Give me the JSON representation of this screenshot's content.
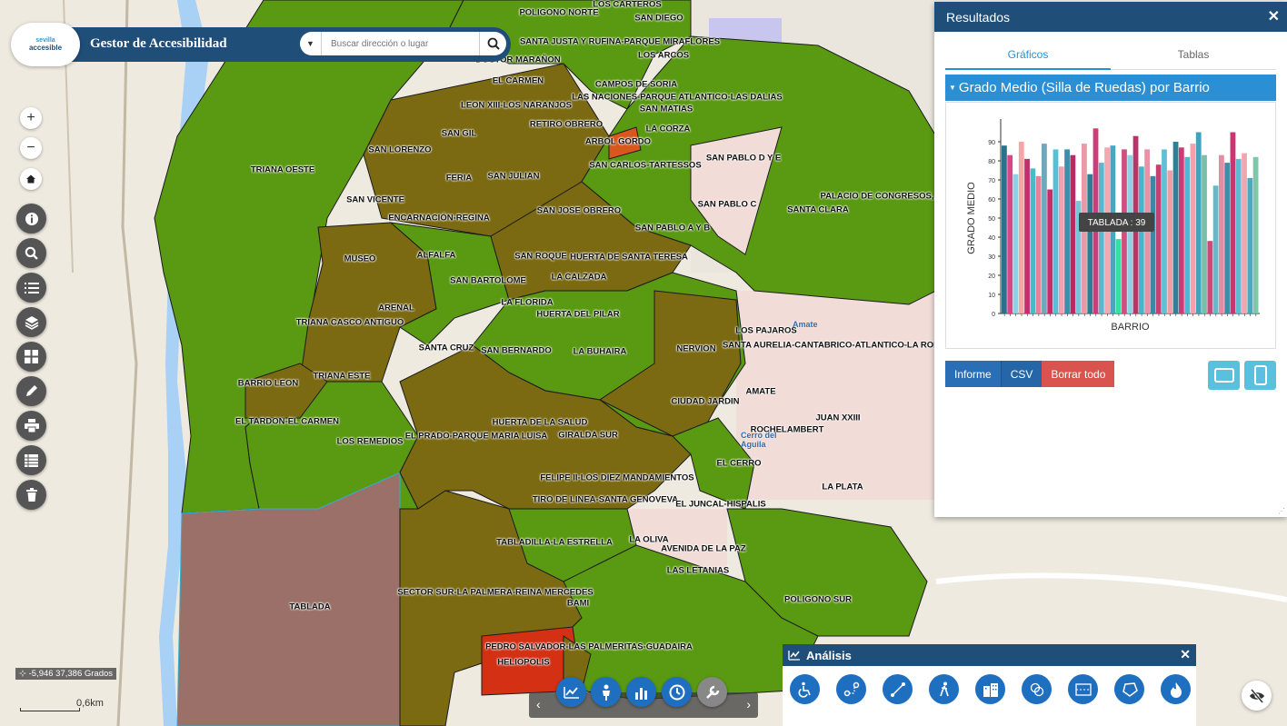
{
  "app": {
    "title": "Gestor de Accesibilidad",
    "logo_text_top": "sevilla",
    "logo_text": "accesible",
    "search_placeholder": "Buscar dirección o lugar"
  },
  "map": {
    "coords": "-5,946 37,386 Grados",
    "scale": "0,6km",
    "neighborhoods": [
      "LOS CARTEROS",
      "POLIGONO NORTE",
      "SAN DIEGO",
      "SANTA JUSTA Y RUFINA-PARQUE MIRAFLORES",
      "LOS ARCOS",
      "DOCTOR MARAÑON",
      "EL CARMEN",
      "CAMPOS DE SORIA",
      "LAS NACIONES-PARQUE ATLANTICO-LAS DALIAS",
      "LEON XIII-LOS NARANJOS",
      "SAN MATIAS",
      "RETIRO OBRERO",
      "LA CORZA",
      "SAN GIL",
      "ARBOL GORDO",
      "SAN LORENZO",
      "SAN PABLO D Y E",
      "SAN CARLOS-TARTESSOS",
      "TRIANA OESTE",
      "FERIA",
      "SAN JULIAN",
      "PALACIO DE CONGRESOS,",
      "SAN VICENTE",
      "SAN PABLO C",
      "SAN JOSE OBRERO",
      "SANTA CLARA",
      "ENCARNACIÓN-REGINA",
      "SAN PABLO A Y B",
      "ALFALFA",
      "SAN ROQUE",
      "HUERTA DE SANTA TERESA",
      "MUSEO",
      "LA CALZADA",
      "SAN BARTOLOME",
      "ARENAL",
      "LA FLORIDA",
      "HUERTA DEL PILAR",
      "TRIANA CASCO ANTIGUO",
      "LOS PAJAROS",
      "SANTA CRUZ",
      "SAN BERNARDO",
      "LA BUHAIRA",
      "NERVION",
      "SANTA AURELIA-CANTABRICO-ATLANTICO-LA ROM",
      "TRIANA ESTE",
      "BARRIO LEON",
      "AMATE",
      "CIUDAD JARDIN",
      "JUAN XXIII",
      "EL TARDON-EL CARMEN",
      "HUERTA DE LA SALUD",
      "ROCHELAMBERT",
      "LOS REMEDIOS",
      "EL PRADO-PARQUE MARIA LUISA",
      "GIRALDA SUR",
      "EL CERRO",
      "FELIPE II-LOS DIEZ MANDAMIENTOS",
      "LA PLATA",
      "TIRO DE LINEA-SANTA GENOVEVA",
      "EL JUNCAL-HISPALIS",
      "LA OLIVA",
      "TABLADILLA-LA ESTRELLA",
      "AVENIDA DE LA PAZ",
      "LAS LETANIAS",
      "TABLADA",
      "SECTOR SUR-LA PALMERA-REINA MERCEDES",
      "BAMI",
      "POLIGONO SUR",
      "PEDRO SALVADOR-LAS PALMERITAS-GUADAIRA",
      "HELIOPOLIS"
    ],
    "places": [
      "Amate",
      "Cerro del Aguila"
    ]
  },
  "results": {
    "title": "Resultados",
    "tabs": [
      "Gráficos",
      "Tablas"
    ],
    "accordion_title": "Grado Medio (Silla de Ruedas) por Barrio",
    "buttons": {
      "informe": "Informe",
      "csv": "CSV",
      "borrar": "Borrar todo"
    },
    "tooltip": "TABLADA : 39"
  },
  "chart_data": {
    "type": "bar",
    "xlabel": "BARRIO",
    "ylabel": "GRADO MEDIO",
    "ylim": [
      0,
      100
    ],
    "yticks": [
      0,
      10,
      20,
      30,
      40,
      50,
      60,
      70,
      80,
      90
    ],
    "values": [
      88,
      83,
      73,
      90,
      81,
      76,
      72,
      89,
      65,
      86,
      77,
      86,
      83,
      59,
      89,
      73,
      97,
      79,
      87,
      88,
      39,
      86,
      83,
      93,
      77,
      86,
      72,
      78,
      86,
      75,
      90,
      87,
      82,
      89,
      95,
      83,
      38,
      67,
      83,
      79,
      95,
      81,
      84,
      71,
      82
    ],
    "colors": [
      "#2e6f8e",
      "#d94686",
      "#8fd0e6",
      "#f4a6a6",
      "#c0306e",
      "#4ab9c9",
      "#e8809b",
      "#6fa7bc",
      "#c92c6d",
      "#55c0d6",
      "#f0a0b0",
      "#3b8fa8",
      "#b62b63",
      "#76c7d9",
      "#e99aa6",
      "#2d7c98",
      "#ce3d77",
      "#5db7cc",
      "#f2a8ae",
      "#4aa5bf",
      "#35e0a0",
      "#d14e80",
      "#8cd3e2",
      "#b8356c",
      "#48b4cc",
      "#e593a5",
      "#3a88a6",
      "#c83f77",
      "#62c0d4",
      "#ef9da9",
      "#2f7f99",
      "#cc3b74",
      "#54b6cb",
      "#f1a2ad",
      "#43a3be",
      "#79bfa9",
      "#d0477c",
      "#6ab7c9",
      "#e48ca1",
      "#3e8ea8",
      "#c53972",
      "#5bbdd2",
      "#f0a6b0",
      "#4ca9c1",
      "#7ec7a9"
    ]
  },
  "analisis": {
    "title": "Análisis"
  }
}
